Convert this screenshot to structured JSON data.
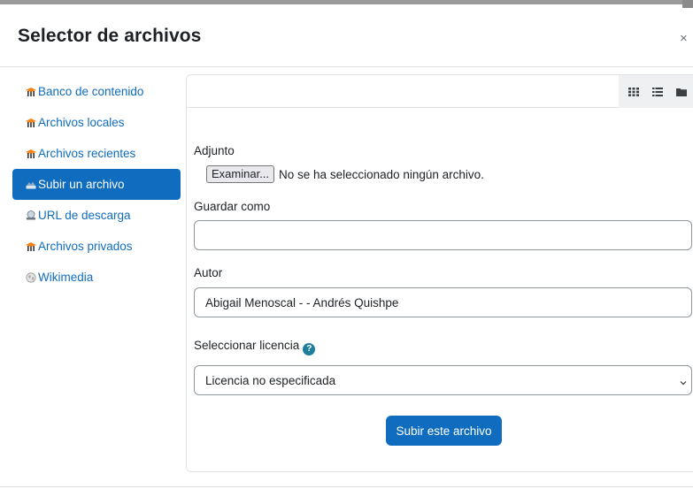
{
  "dialog": {
    "title": "Selector de archivos",
    "close_label": "×"
  },
  "sidebar": {
    "items": [
      {
        "label": "Banco de contenido",
        "icon": "moodle-hat-icon"
      },
      {
        "label": "Archivos locales",
        "icon": "moodle-hat-icon"
      },
      {
        "label": "Archivos recientes",
        "icon": "moodle-hat-icon"
      },
      {
        "label": "Subir un archivo",
        "icon": "upload-icon",
        "active": true
      },
      {
        "label": "URL de descarga",
        "icon": "url-download-icon"
      },
      {
        "label": "Archivos privados",
        "icon": "moodle-hat-icon"
      },
      {
        "label": "Wikimedia",
        "icon": "wikimedia-globe-icon"
      }
    ]
  },
  "toolbar": {
    "view_buttons": [
      "icons-view-icon",
      "list-view-icon",
      "tree-view-icon"
    ]
  },
  "form": {
    "attachment_label": "Adjunto",
    "browse_button": "Examinar...",
    "no_file_text": "No se ha seleccionado ningún archivo.",
    "save_as_label": "Guardar como",
    "save_as_value": "",
    "author_label": "Autor",
    "author_value": "Abigail Menoscal - - Andrés Quishpe",
    "license_label": "Seleccionar licencia",
    "license_value": "Licencia no especificada",
    "submit_label": "Subir este archivo"
  },
  "colors": {
    "accent": "#0f6cbf",
    "help": "#1f7e9a"
  }
}
